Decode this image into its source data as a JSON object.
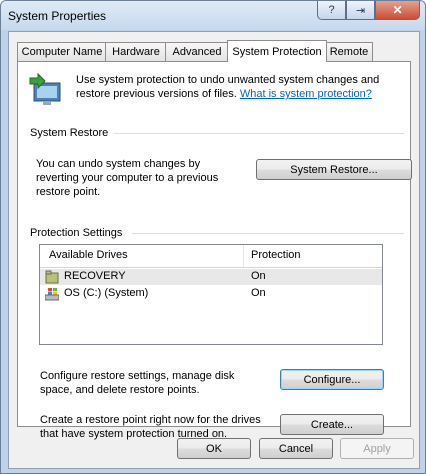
{
  "window": {
    "title": "System Properties"
  },
  "caption": {
    "help_glyph": "?",
    "restore_glyph": "⇥",
    "close_glyph": "✕"
  },
  "tabs": [
    {
      "label": "Computer Name"
    },
    {
      "label": "Hardware"
    },
    {
      "label": "Advanced"
    },
    {
      "label": "System Protection",
      "active": true
    },
    {
      "label": "Remote"
    }
  ],
  "intro": {
    "text": "Use system protection to undo unwanted system changes and restore previous versions of files.",
    "link": "What is system protection?"
  },
  "system_restore": {
    "group_label": "System Restore",
    "text": "You can undo system changes by reverting your computer to a previous restore point.",
    "button": "System Restore..."
  },
  "protection_settings": {
    "group_label": "Protection Settings",
    "columns": [
      "Available Drives",
      "Protection"
    ],
    "drives": [
      {
        "name": "RECOVERY",
        "protection": "On",
        "icon": "folder-drive-icon"
      },
      {
        "name": "OS (C:) (System)",
        "protection": "On",
        "icon": "windows-drive-icon"
      }
    ],
    "configure_text": "Configure restore settings, manage disk space, and delete restore points.",
    "configure_button": "Configure...",
    "create_text": "Create a restore point right now for the drives that have system protection turned on.",
    "create_button": "Create..."
  },
  "footer": {
    "ok": "OK",
    "cancel": "Cancel",
    "apply": "Apply"
  }
}
